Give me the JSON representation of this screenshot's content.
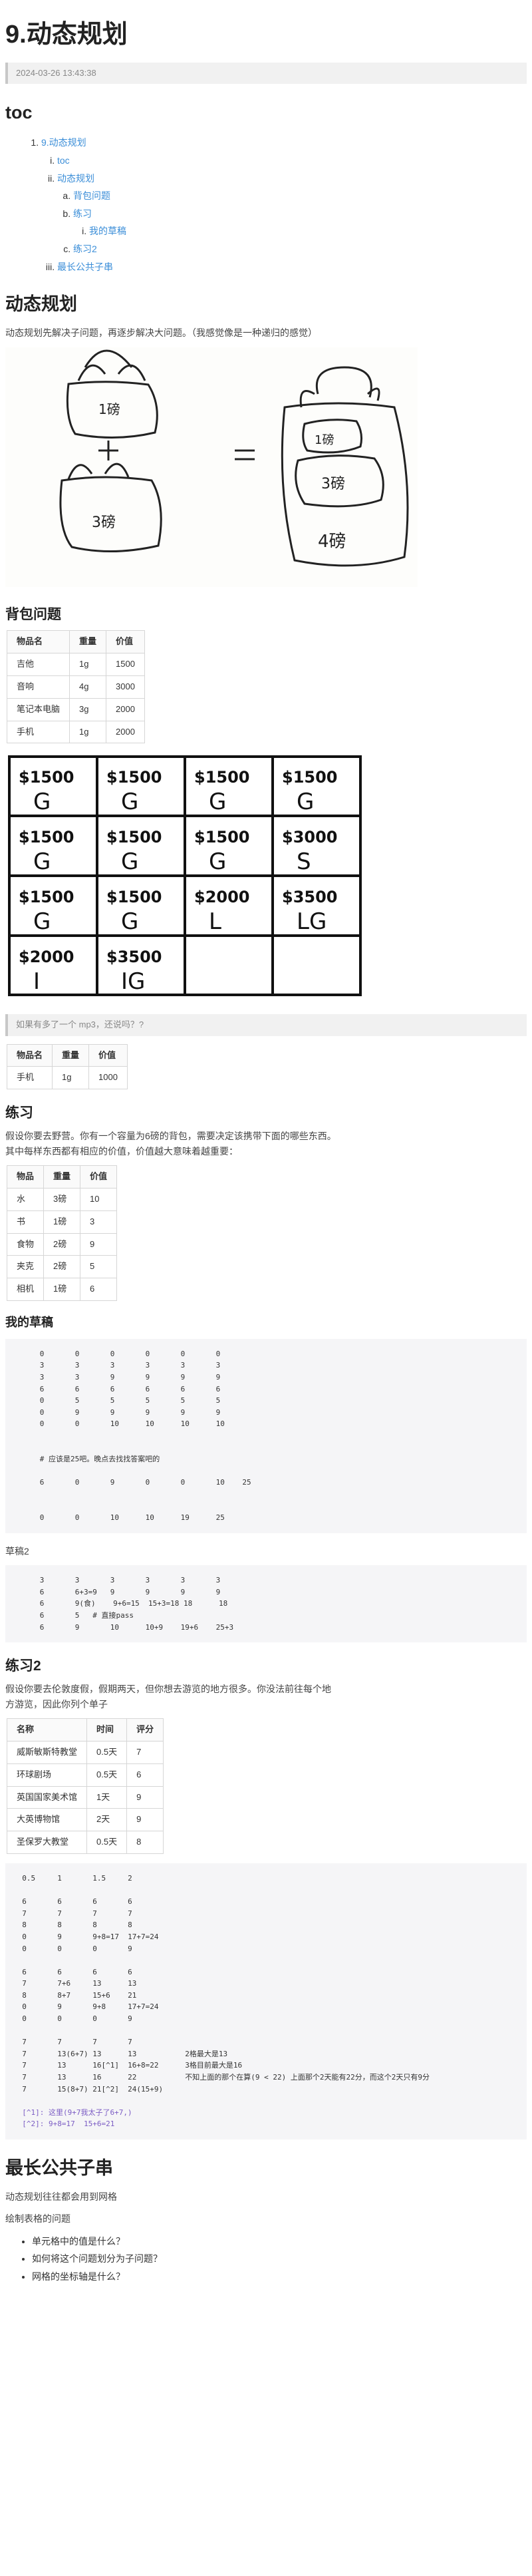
{
  "title": "9.动态规划",
  "date": "2024-03-26 13:43:38",
  "toc_heading": "toc",
  "toc": {
    "item1": "9.动态规划",
    "item1_1": "toc",
    "item1_2": "动态规划",
    "item1_2_a": "背包问题",
    "item1_2_b": "练习",
    "item1_2_b_i": "我的草稿",
    "item1_2_c": "练习2",
    "item1_3": "最长公共子串"
  },
  "dp_heading": "动态规划",
  "dp_intro": "动态规划先解决子问题，再逐步解决大问题。（我感觉像是一种递归的感觉）",
  "bags_image": {
    "bag1": "1磅",
    "bag2": "3磅",
    "plus": "+",
    "equals": "=",
    "big_bag1": "1磅",
    "big_bag2": "3磅",
    "total": "4磅"
  },
  "knapsack_heading": "背包问题",
  "table1": {
    "headers": [
      "物品名",
      "重量",
      "价值"
    ],
    "rows": [
      [
        "吉他",
        "1g",
        "1500"
      ],
      [
        "音响",
        "4g",
        "3000"
      ],
      [
        "笔记本电脑",
        "3g",
        "2000"
      ],
      [
        "手机",
        "1g",
        "2000"
      ]
    ]
  },
  "grid_image": {
    "cells": [
      [
        "$1500",
        "G",
        "$1500",
        "G",
        "$1500",
        "G",
        "$1500",
        "G"
      ],
      [
        "$1500",
        "G",
        "$1500",
        "G",
        "$1500",
        "G",
        "$3000",
        "S"
      ],
      [
        "$1500",
        "G",
        "$1500",
        "G",
        "$2000",
        "L",
        "$3500",
        "LG"
      ],
      [
        "$2000",
        "I",
        "$3500",
        "IG",
        "",
        "",
        "",
        ""
      ]
    ]
  },
  "quote1": "如果有多了一个 mp3，还说吗？?",
  "table2": {
    "headers": [
      "物品名",
      "重量",
      "价值"
    ],
    "rows": [
      [
        "手机",
        "1g",
        "1000"
      ]
    ]
  },
  "practice_heading": "练习",
  "practice_text": "假设你要去野营。你有一个容量为6磅的背包，需要决定该携带下面的哪些东西。其中每样东西都有相应的价值，价值越大意味着越重要：",
  "table3": {
    "headers": [
      "物品",
      "重量",
      "价值"
    ],
    "rows": [
      [
        "水",
        "3磅",
        "10"
      ],
      [
        "书",
        "1磅",
        "3"
      ],
      [
        "食物",
        "2磅",
        "9"
      ],
      [
        "夹克",
        "2磅",
        "5"
      ],
      [
        "相机",
        "1磅",
        "6"
      ]
    ]
  },
  "draft_heading": "我的草稿",
  "code1": "      0       0       0       0       0       0\n      3       3       3       3       3       3\n      3       3       9       9       9       9\n      6       6       6       6       6       6\n      0       5       5       5       5       5\n      0       9       9       9       9       9\n      0       0       10      10      10      10\n\n\n      # 应该是25吧。晚点去找找答案吧的\n\n      6       0       9       0       0       10    25\n\n\n      0       0       10      10      19      25",
  "draft2_label": "草稿2",
  "code2": "      3       3       3       3       3       3\n      6       6+3=9   9       9       9       9\n      6       9(食)    9+6=15  15+3=18 18      18\n      6       5   # 直接pass\n      6       9       10      10+9    19+6    25+3",
  "practice2_heading": "练习2",
  "practice2_text": "假设你要去伦敦度假，假期两天，但你想去游览的地方很多。你没法前往每个地方游览，因此你列个单子",
  "table4": {
    "headers": [
      "名称",
      "时间",
      "评分"
    ],
    "rows": [
      [
        "威斯敏斯特教堂",
        "0.5天",
        "7"
      ],
      [
        "环球剧场",
        "0.5天",
        "6"
      ],
      [
        "英国国家美术馆",
        "1天",
        "9"
      ],
      [
        "大英博物馆",
        "2天",
        "9"
      ],
      [
        "圣保罗大教堂",
        "0.5天",
        "8"
      ]
    ]
  },
  "code3": "  0.5     1       1.5     2\n\n  6       6       6       6\n  7       7       7       7\n  8       8       8       8\n  0       9       9+8=17  17+7=24\n  0       0       0       9\n\n  6       6       6       6\n  7       7+6     13      13\n  8       8+7     15+6    21\n  0       9       9+8     17+7=24\n  0       0       0       9\n\n  7       7       7       7\n  7       13(6+7) 13      13           2格最大是13\n  7       13      16[^1]  16+8=22      3格目前最大是16\n  7       13      16      22           不知上面的那个在算(9 < 22) 上面那个2天能有22分，而这个2天只有9分\n  7       15(8+7) 21[^2]  24(15+9)",
  "footnote1": "  [^1]: 这里(9+7我太子了6+7,)",
  "footnote2": "  [^2]: 9+8=17  15+6=21",
  "lcs_heading": "最长公共子串",
  "lcs_text1": "动态规划往往都会用到网格",
  "lcs_text2": "绘制表格的问题",
  "lcs_list": [
    "单元格中的值是什么？",
    "如何将这个问题划分为子问题？",
    "网格的坐标轴是什么？"
  ]
}
